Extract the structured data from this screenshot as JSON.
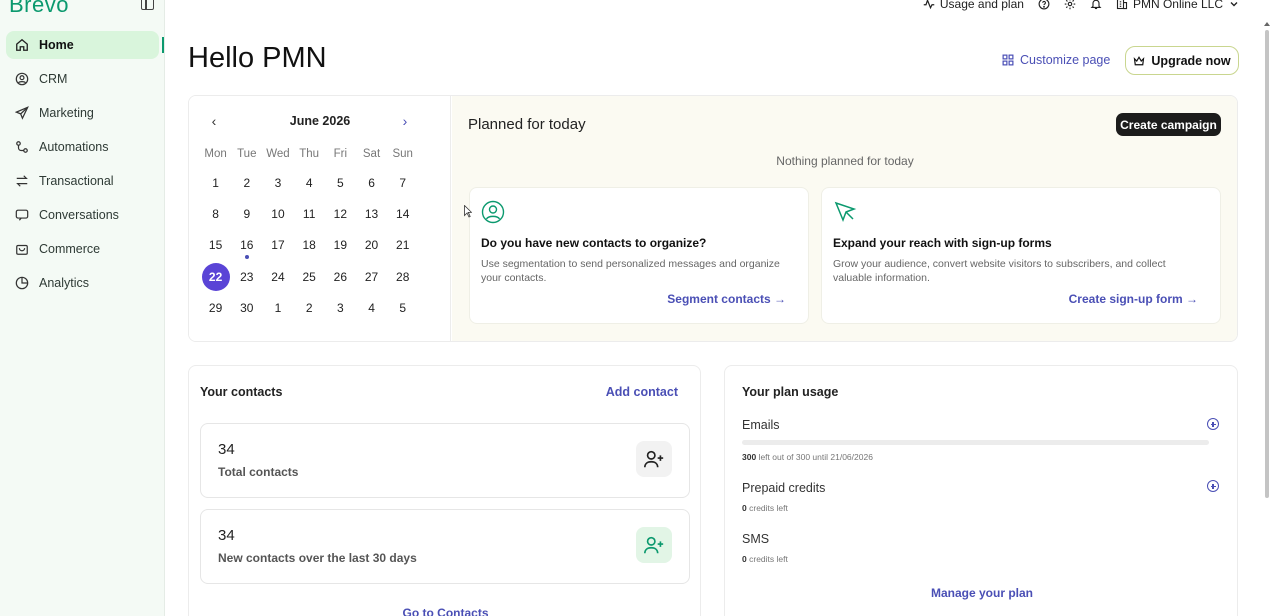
{
  "sidebar": {
    "brand": "Brevo",
    "items": [
      {
        "label": "Home",
        "icon": "home-icon",
        "active": true
      },
      {
        "label": "CRM",
        "icon": "user-circle-icon"
      },
      {
        "label": "Marketing",
        "icon": "send-icon"
      },
      {
        "label": "Automations",
        "icon": "flow-icon"
      },
      {
        "label": "Transactional",
        "icon": "arrows-icon"
      },
      {
        "label": "Conversations",
        "icon": "chat-icon"
      },
      {
        "label": "Commerce",
        "icon": "bag-icon"
      },
      {
        "label": "Analytics",
        "icon": "pie-icon"
      }
    ]
  },
  "topbar": {
    "usage_label": "Usage and plan",
    "account_label": "PMN Online LLC"
  },
  "header": {
    "title": "Hello PMN",
    "customize_label": "Customize page",
    "upgrade_label": "Upgrade now"
  },
  "calendar": {
    "month_label": "June 2026",
    "weekdays": [
      "Mon",
      "Tue",
      "Wed",
      "Thu",
      "Fri",
      "Sat",
      "Sun"
    ],
    "days": [
      "1",
      "2",
      "3",
      "4",
      "5",
      "6",
      "7",
      "8",
      "9",
      "10",
      "11",
      "12",
      "13",
      "14",
      "15",
      "16",
      "17",
      "18",
      "19",
      "20",
      "21",
      "22",
      "23",
      "24",
      "25",
      "26",
      "27",
      "28",
      "29",
      "30",
      "1",
      "2",
      "3",
      "4",
      "5"
    ],
    "today": "22",
    "marked": "16"
  },
  "planned": {
    "title": "Planned for today",
    "create_label": "Create campaign",
    "empty_text": "Nothing planned for today",
    "tips": [
      {
        "title": "Do you have new contacts to organize?",
        "text": "Use segmentation to send personalized messages and organize your contacts.",
        "link": "Segment contacts"
      },
      {
        "title": "Expand your reach with sign-up forms",
        "text": "Grow your audience, convert website visitors to subscribers, and collect valuable information.",
        "link": "Create sign-up form"
      }
    ]
  },
  "contacts": {
    "title": "Your contacts",
    "add_label": "Add contact",
    "total_value": "34",
    "total_label": "Total contacts",
    "new_value": "34",
    "new_label": "New contacts over the last 30 days",
    "go_label": "Go to Contacts"
  },
  "usage": {
    "title": "Your plan usage",
    "emails_label": "Emails",
    "emails_left": "300",
    "emails_suffix": "left out of 300 until 21/06/2026",
    "emails_used_fraction": 0,
    "prepaid_label": "Prepaid credits",
    "prepaid_value": "0",
    "prepaid_suffix": "credits left",
    "sms_label": "SMS",
    "sms_value": "0",
    "sms_suffix": "credits left",
    "manage_label": "Manage your plan"
  },
  "colors": {
    "brand": "#0b996e",
    "accent": "#4a4fb5",
    "today": "#5a44d6"
  }
}
